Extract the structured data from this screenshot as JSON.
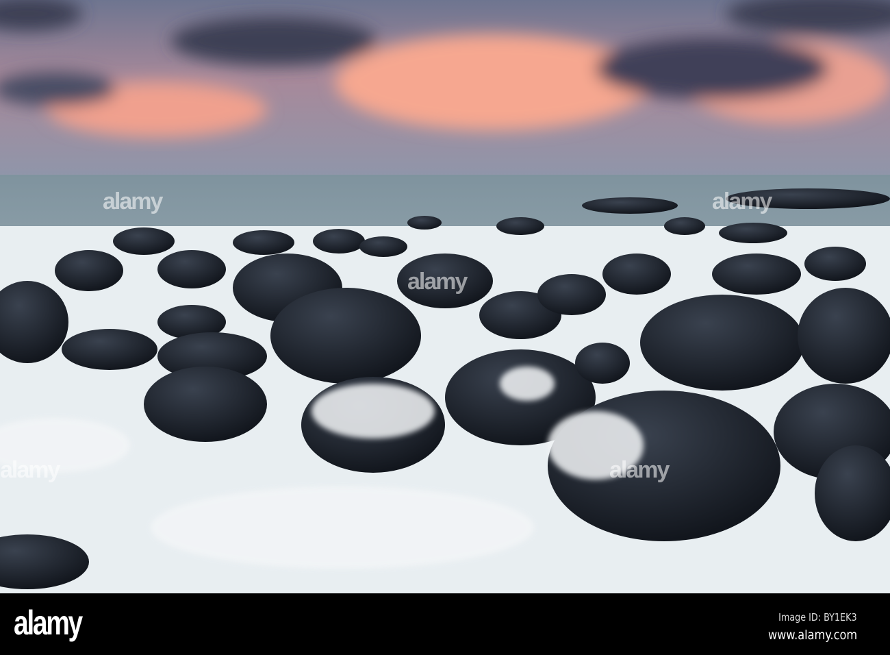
{
  "photo": {
    "subject": "rocky-shore-at-dusk"
  },
  "watermark": {
    "text": "alamy"
  },
  "footer": {
    "logo": "alamy",
    "image_id": "Image ID: BY1EK3",
    "website": "www.alamy.com"
  },
  "colors": {
    "sky_top": "#6f7890",
    "cloud_pink": "#f0a08e",
    "cloud_dark": "#3d3f55",
    "sea": "#9fb2bb",
    "rock": "#1c222c",
    "foam": "#f1f4f6"
  }
}
